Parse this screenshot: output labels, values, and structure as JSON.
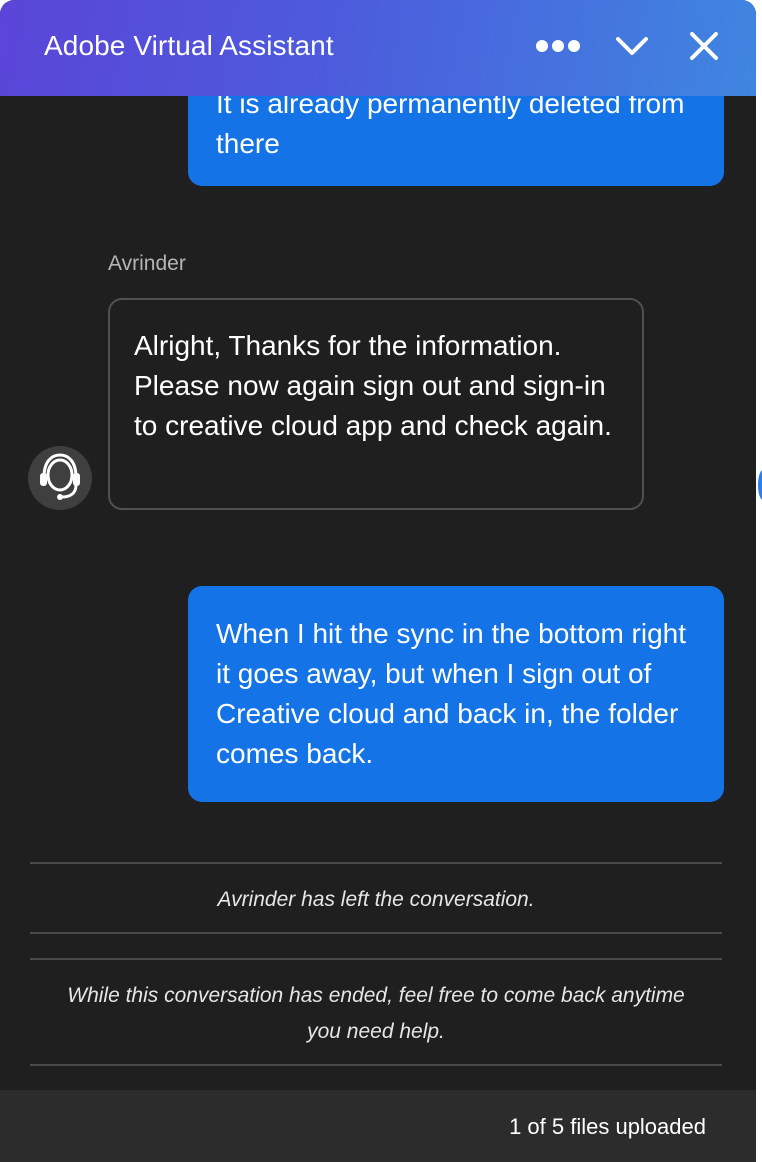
{
  "header": {
    "title": "Adobe Virtual Assistant",
    "more_icon": "more-horizontal-icon",
    "collapse_icon": "chevron-down-icon",
    "close_icon": "close-icon"
  },
  "messages": [
    {
      "sender": "user",
      "text": "It is already permanently deleted from there"
    },
    {
      "sender": "agent",
      "name": "Avrinder",
      "avatar_icon": "headset-support-icon",
      "text": "Alright, Thanks for the information. Please now again sign out and sign-in to creative cloud app and check again."
    },
    {
      "sender": "user",
      "text": "When I hit the sync in the bottom right it goes away, but when I sign out of Creative cloud and back in, the folder comes back."
    }
  ],
  "system": {
    "left_notice": "Avrinder has left the conversation.",
    "ended_notice": "While this conversation has ended, feel free to come back anytime you need help."
  },
  "footer": {
    "upload_status": "1 of 5 files uploaded"
  },
  "colors": {
    "background": "#1f1f1f",
    "user_bubble": "#1473e6",
    "header_gradient_start": "#5a45d8",
    "header_gradient_end": "#3f86e0"
  }
}
